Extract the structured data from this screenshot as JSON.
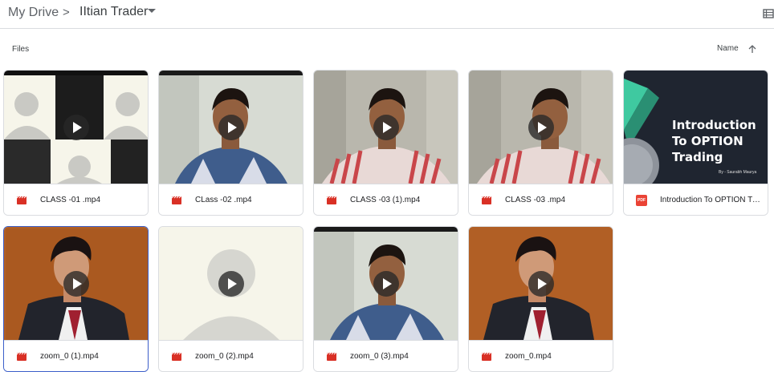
{
  "breadcrumb": {
    "root": "My Drive",
    "separator": ">",
    "current": "IItian Trader"
  },
  "section": {
    "label": "Files"
  },
  "sort": {
    "label": "Name",
    "direction": "ascending"
  },
  "colors": {
    "video_icon": "#d93025",
    "pdf_icon": "#ea4335",
    "selection_border": "#3b5ec9"
  },
  "files": [
    {
      "name": "CLASS -01 .mp4",
      "type": "video",
      "icon": "video-file-icon"
    },
    {
      "name": "CLass -02 .mp4",
      "type": "video",
      "icon": "video-file-icon"
    },
    {
      "name": "CLASS -03 (1).mp4",
      "type": "video",
      "icon": "video-file-icon"
    },
    {
      "name": "CLASS -03 .mp4",
      "type": "video",
      "icon": "video-file-icon"
    },
    {
      "name": "Introduction To OPTION Trading.pdf",
      "type": "pdf",
      "icon": "pdf-file-icon",
      "thumb_title": "Introduction To OPTION Trading",
      "thumb_byline": "By - Saurabh Maurya",
      "pdf_badge": "PDF"
    },
    {
      "name": "zoom_0 (1).mp4",
      "type": "video",
      "icon": "video-file-icon",
      "selected": true
    },
    {
      "name": "zoom_0 (2).mp4",
      "type": "video",
      "icon": "video-file-icon"
    },
    {
      "name": "zoom_0 (3).mp4",
      "type": "video",
      "icon": "video-file-icon"
    },
    {
      "name": "zoom_0.mp4",
      "type": "video",
      "icon": "video-file-icon"
    }
  ]
}
